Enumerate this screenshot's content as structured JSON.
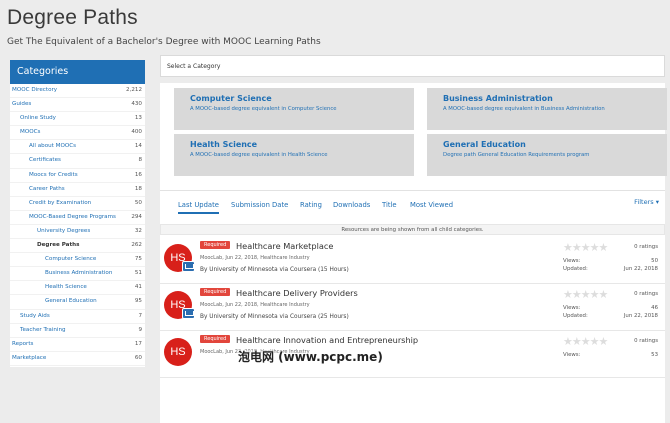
{
  "page": {
    "title": "Degree Paths",
    "subtitle": "Get The Equivalent of a Bachelor's Degree with MOOC Learning Paths"
  },
  "sidebar": {
    "heading": "Categories",
    "items": [
      {
        "label": "MOOC Directory",
        "count": "2,212"
      },
      {
        "label": "Guides",
        "count": "430"
      },
      {
        "label": "Online Study",
        "count": "13"
      },
      {
        "label": "MOOCs",
        "count": "400"
      },
      {
        "label": "All about MOOCs",
        "count": "14"
      },
      {
        "label": "Certificates",
        "count": "8"
      },
      {
        "label": "Moocs for Credits",
        "count": "16"
      },
      {
        "label": "Career Paths",
        "count": "18"
      },
      {
        "label": "Credit by Examination",
        "count": "50"
      },
      {
        "label": "MOOC-Based Degree Programs",
        "count": "294"
      },
      {
        "label": "University Degrees",
        "count": "32"
      },
      {
        "label": "Degree Paths",
        "count": "262"
      },
      {
        "label": "Computer Science",
        "count": "75"
      },
      {
        "label": "Business Administration",
        "count": "51"
      },
      {
        "label": "Health Science",
        "count": "41"
      },
      {
        "label": "General Education",
        "count": "95"
      },
      {
        "label": "Study Aids",
        "count": "7"
      },
      {
        "label": "Teacher Training",
        "count": "9"
      },
      {
        "label": "Reports",
        "count": "17"
      },
      {
        "label": "Marketplace",
        "count": "60"
      }
    ]
  },
  "select_category": "Select a Category",
  "categories": [
    {
      "title": "Computer Science",
      "desc": "A MOOC-based degree equivalent in Computer Science"
    },
    {
      "title": "Business Administration",
      "desc": "A MOOC-based degree equivalent in Business Administration"
    },
    {
      "title": "Health Science",
      "desc": "A MOOC-based degree equivalent in Health Science"
    },
    {
      "title": "General Education",
      "desc": "Degree path General Education Requirements program"
    }
  ],
  "tabs": [
    "Last Update",
    "Submission Date",
    "Rating",
    "Downloads",
    "Title",
    "Most Viewed"
  ],
  "filters_label": "Filters",
  "notice": "Resources are being shown from all child categories.",
  "items": [
    {
      "logo": "HS",
      "badge": "Required",
      "title": "Healthcare Marketplace",
      "meta": "MoocLab, Jun 22, 2018, Healthcare Industry",
      "by": "By University of Minnesota via Coursera (15 Hours)",
      "ratings": "0 ratings",
      "views_label": "Views:",
      "views": "50",
      "updated_label": "Updated:",
      "updated": "Jun 22, 2018"
    },
    {
      "logo": "HS",
      "badge": "Required",
      "title": "Healthcare Delivery Providers",
      "meta": "MoocLab, Jun 22, 2018, Healthcare Industry",
      "by": "By University of Minnesota via Coursera (25 Hours)",
      "ratings": "0 ratings",
      "views_label": "Views:",
      "views": "46",
      "updated_label": "Updated:",
      "updated": "Jun 22, 2018"
    },
    {
      "logo": "HS",
      "badge": "Required",
      "title": "Healthcare Innovation and Entrepreneurship",
      "meta": "MoocLab, Jun 22, 2018, Healthcare Industry",
      "by": "",
      "ratings": "0 ratings",
      "views_label": "Views:",
      "views": "53",
      "updated_label": "",
      "updated": ""
    }
  ],
  "watermark": "泡电网 (www.pcpc.me)",
  "colors": {
    "accent": "#1f6fb4",
    "required_badge": "#e2463c",
    "logo": "#d8201a"
  }
}
